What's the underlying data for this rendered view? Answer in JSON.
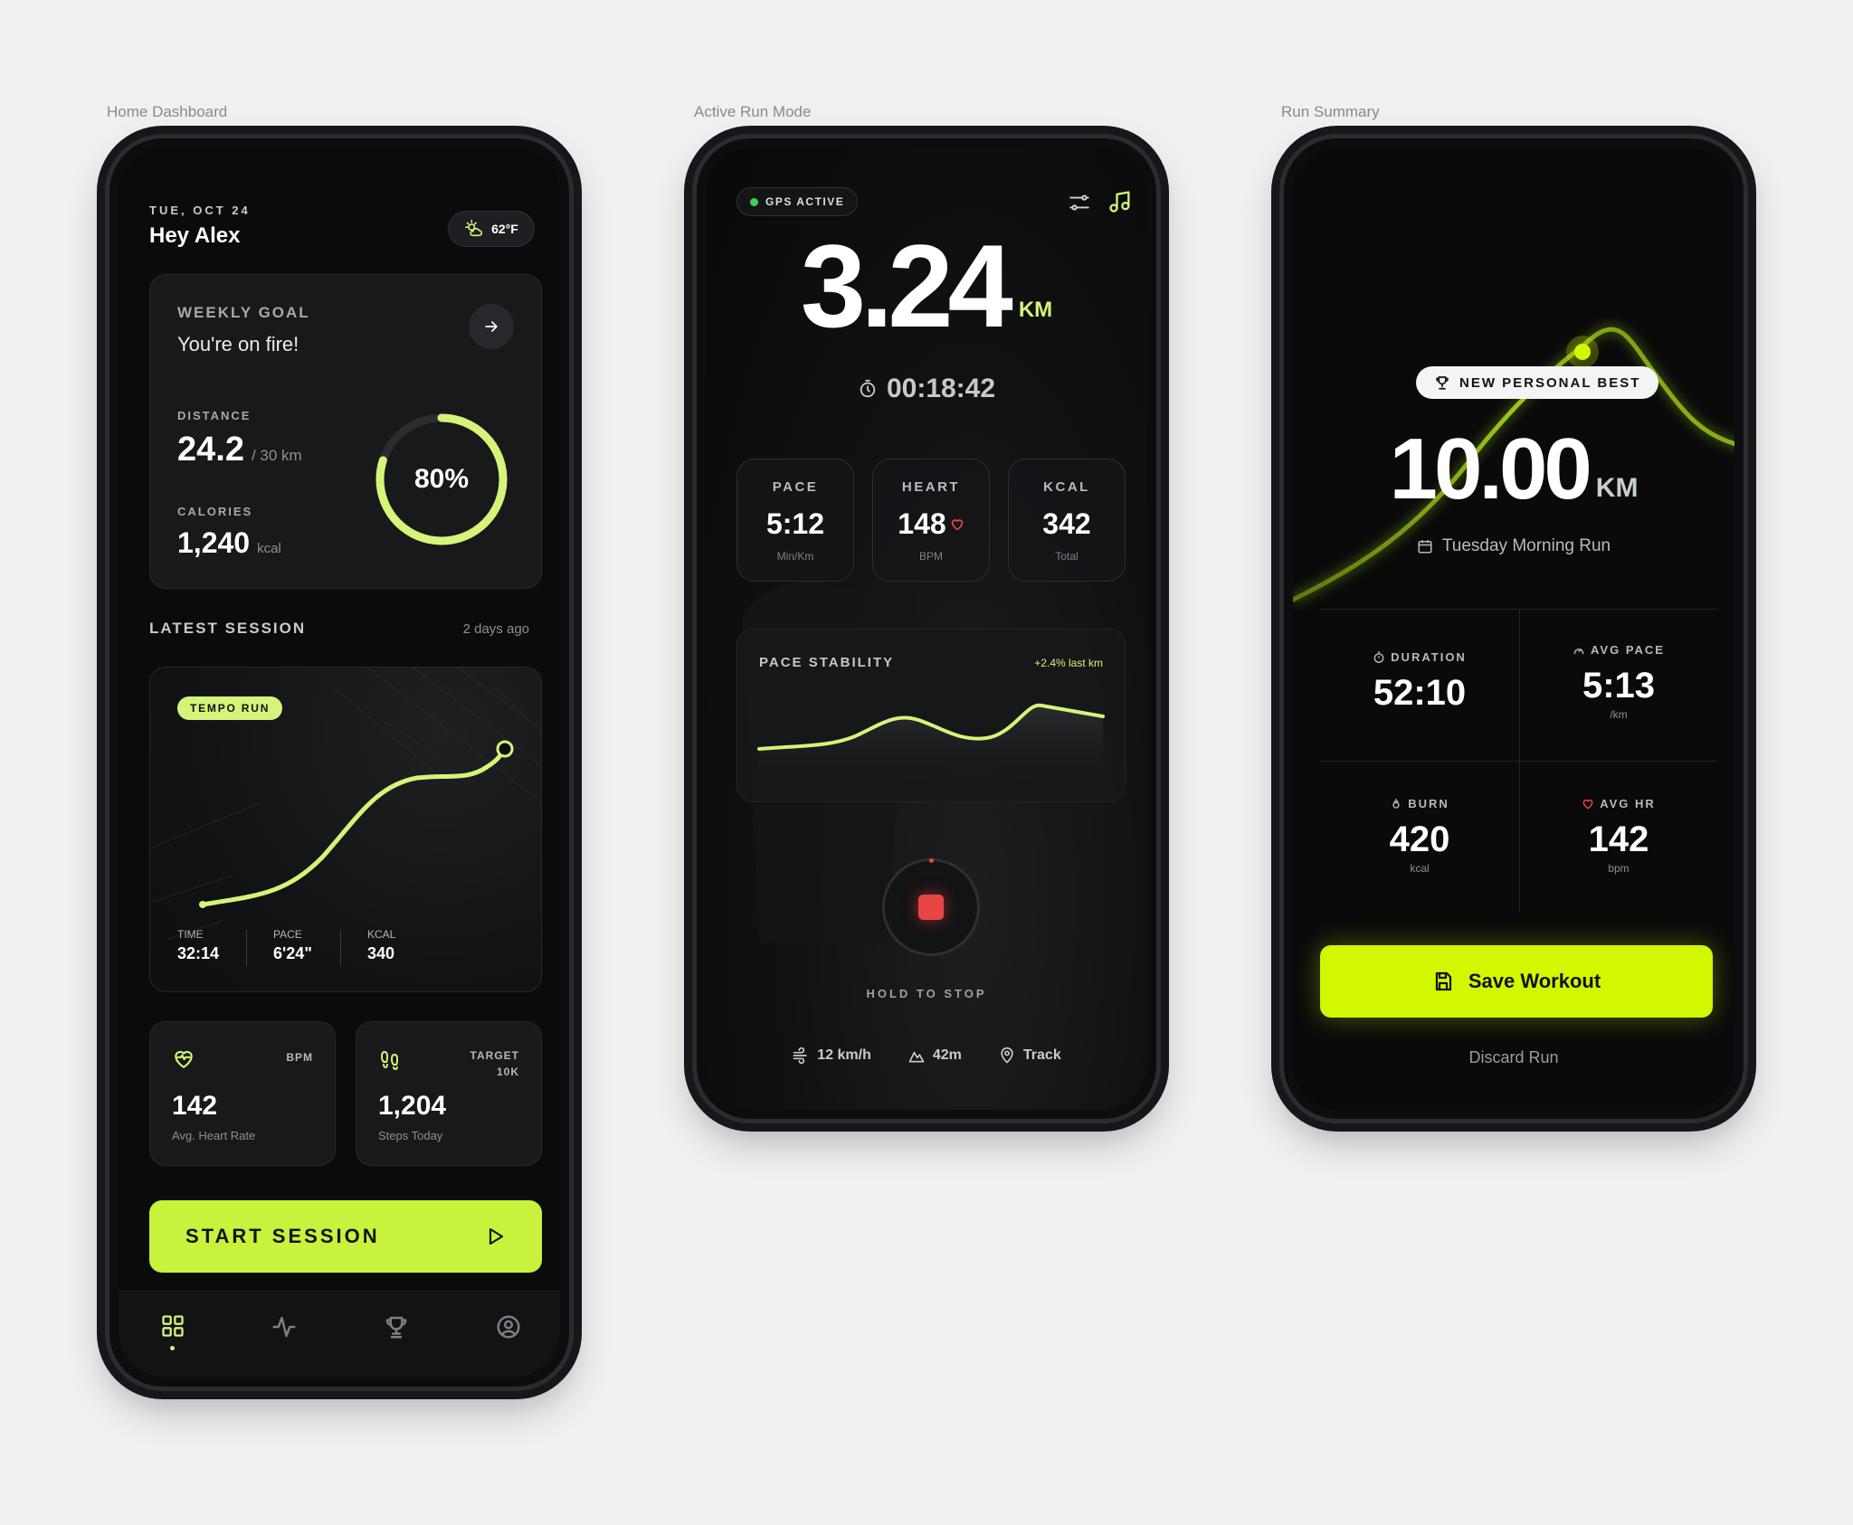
{
  "captions": {
    "home": "Home Dashboard",
    "active": "Active Run Mode",
    "summary": "Run Summary"
  },
  "home": {
    "date": "TUE, OCT 24",
    "greeting": "Hey Alex",
    "weather": "62°F",
    "weekly_goal": {
      "label": "WEEKLY GOAL",
      "subtitle": "You're on fire!",
      "distance_label": "DISTANCE",
      "distance_value": "24.2",
      "distance_target": "/ 30 km",
      "calories_label": "CALORIES",
      "calories_value": "1,240",
      "calories_unit": "kcal",
      "progress_text": "80%",
      "progress": 0.8
    },
    "latest_session": {
      "label": "LATEST SESSION",
      "when": "2 days ago",
      "badge": "TEMPO RUN",
      "time_label": "TIME",
      "time_value": "32:14",
      "pace_label": "PACE",
      "pace_value": "6'24\"",
      "kcal_label": "KCAL",
      "kcal_value": "340"
    },
    "heart": {
      "unit": "BPM",
      "value": "142",
      "caption": "Avg. Heart Rate"
    },
    "steps": {
      "target_line1": "TARGET",
      "target_line2": "10K",
      "value": "1,204",
      "caption": "Steps Today"
    },
    "start_button": "START SESSION",
    "accent": "#c8f23c"
  },
  "active": {
    "gps": "GPS ACTIVE",
    "distance": "3.24",
    "unit": "KM",
    "timer": "00:18:42",
    "stats": [
      {
        "title": "PACE",
        "value": "5:12",
        "unit": "Min/Km"
      },
      {
        "title": "HEART",
        "value": "148",
        "unit": "BPM"
      },
      {
        "title": "KCAL",
        "value": "342",
        "unit": "Total"
      }
    ],
    "stability": {
      "label": "PACE STABILITY",
      "delta": "+2.4% last km"
    },
    "stop_label": "HOLD TO STOP",
    "footer": {
      "speed": "12 km/h",
      "elevation": "42m",
      "track": "Track"
    },
    "stop_color": "#e84545"
  },
  "summary": {
    "badge": "NEW PERSONAL BEST",
    "distance": "10.00",
    "unit": "KM",
    "run_name": "Tuesday Morning Run",
    "duration": {
      "label": "DURATION",
      "value": "52:10"
    },
    "avg_pace": {
      "label": "AVG PACE",
      "value": "5:13",
      "unit": "/km"
    },
    "burn": {
      "label": "BURN",
      "value": "420",
      "unit": "kcal"
    },
    "avg_hr": {
      "label": "AVG HR",
      "value": "142",
      "unit": "bpm"
    },
    "save_button": "Save Workout",
    "discard": "Discard Run",
    "accent": "#d2f700"
  }
}
